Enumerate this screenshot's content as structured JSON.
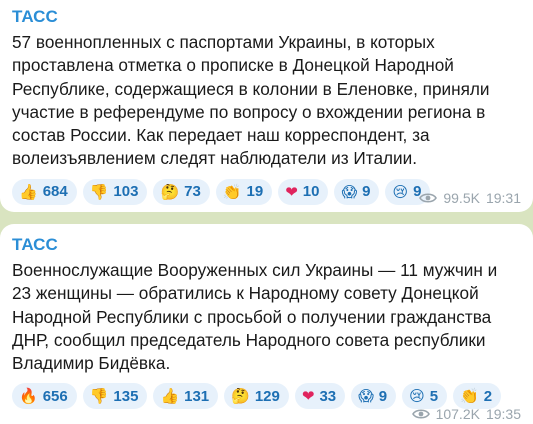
{
  "messages": [
    {
      "author": "ТАСС",
      "text": "57 военнопленных с паспортами Украины, в которых проставлена отметка о прописке в Донецкой Народной Республике, содержащиеся в колонии в Еленовке, приняли участие в референдуме по вопросу о вхождении региона в состав России. Как передает наш корреспондент, за волеизъявлением следят наблюдатели из Италии.",
      "reactions": [
        {
          "emoji": "👍",
          "count": "684"
        },
        {
          "emoji": "👎",
          "count": "103"
        },
        {
          "emoji": "🤔",
          "count": "73"
        },
        {
          "emoji": "👏",
          "count": "19"
        },
        {
          "emoji": "❤",
          "count": "10"
        },
        {
          "emoji": "😱",
          "count": "9"
        },
        {
          "emoji": "😢",
          "count": "9"
        }
      ],
      "views": "99.5K",
      "time": "19:31"
    },
    {
      "author": "ТАСС",
      "text": "Военнослужащие Вооруженных сил Украины — 11 мужчин и 23 женщины — обратились к Народному совету Донецкой Народной Республики с просьбой о получении гражданства ДНР, сообщил председатель Народного совета республики Владимир Бидёвка.",
      "reactions": [
        {
          "emoji": "🔥",
          "count": "656"
        },
        {
          "emoji": "👎",
          "count": "135"
        },
        {
          "emoji": "👍",
          "count": "131"
        },
        {
          "emoji": "🤔",
          "count": "129"
        },
        {
          "emoji": "❤",
          "count": "33"
        },
        {
          "emoji": "😱",
          "count": "9"
        },
        {
          "emoji": "😢",
          "count": "5"
        },
        {
          "emoji": "👏",
          "count": "2"
        }
      ],
      "views": "107.2K",
      "time": "19:35"
    }
  ],
  "colors": {
    "background": "#d9e4c0",
    "author": "#2b8ed6",
    "reaction_bg": "#e7f1fb",
    "reaction_text": "#1d6fb3",
    "meta_text": "#9aa5ad"
  }
}
